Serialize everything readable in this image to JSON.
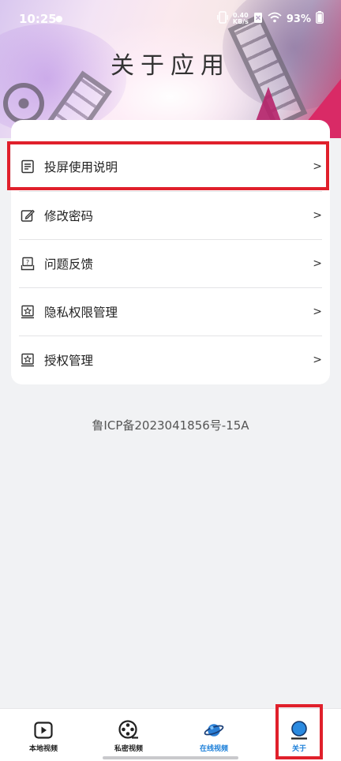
{
  "status_bar": {
    "time": "10:25",
    "net_speed_value": "0.40",
    "net_speed_unit": "KB/s",
    "battery": "93%"
  },
  "header": {
    "title": "关于应用"
  },
  "menu": {
    "items": [
      {
        "label": "投屏使用说明",
        "icon": "document-icon",
        "chevron": ">"
      },
      {
        "label": "修改密码",
        "icon": "edit-icon",
        "chevron": ">"
      },
      {
        "label": "问题反馈",
        "icon": "feedback-icon",
        "chevron": ">"
      },
      {
        "label": "隐私权限管理",
        "icon": "privacy-icon",
        "chevron": ">"
      },
      {
        "label": "授权管理",
        "icon": "authorization-icon",
        "chevron": ">"
      }
    ]
  },
  "footer": {
    "icp": "鲁ICP备2023041856号-15A"
  },
  "bottom_nav": {
    "items": [
      {
        "label": "本地视频",
        "icon": "play-icon"
      },
      {
        "label": "私密视频",
        "icon": "film-reel-icon"
      },
      {
        "label": "在线视频",
        "icon": "planet-icon"
      },
      {
        "label": "关于",
        "icon": "about-icon",
        "active": true
      }
    ]
  },
  "colors": {
    "accent": "#1b7fd9",
    "highlight": "#e0202b",
    "background": "#f1f2f4"
  }
}
